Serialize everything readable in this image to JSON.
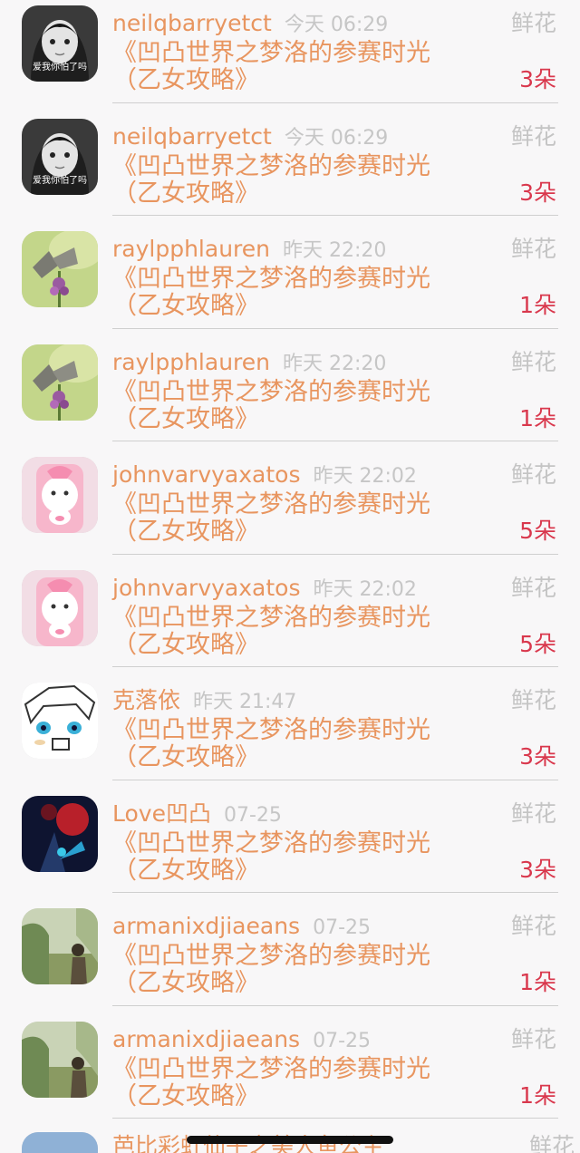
{
  "gifts": [
    {
      "user": "neilqbarryetct",
      "time": "今天 06:29",
      "gift": "鲜花",
      "message": "《凹凸世界之梦洛的参赛时光（乙女攻略》",
      "count": "3朵",
      "avatar_icon": "avatar-girl-bw-icon",
      "avatar_caption": "爱我你怕了吗"
    },
    {
      "user": "neilqbarryetct",
      "time": "今天 06:29",
      "gift": "鲜花",
      "message": "《凹凸世界之梦洛的参赛时光（乙女攻略》",
      "count": "3朵",
      "avatar_icon": "avatar-girl-bw-icon",
      "avatar_caption": "爱我你怕了吗"
    },
    {
      "user": "raylpphlauren",
      "time": "昨天 22:20",
      "gift": "鲜花",
      "message": "《凹凸世界之梦洛的参赛时光（乙女攻略》",
      "count": "1朵",
      "avatar_icon": "avatar-butterfly-icon",
      "avatar_caption": ""
    },
    {
      "user": "raylpphlauren",
      "time": "昨天 22:20",
      "gift": "鲜花",
      "message": "《凹凸世界之梦洛的参赛时光（乙女攻略》",
      "count": "1朵",
      "avatar_icon": "avatar-butterfly-icon",
      "avatar_caption": ""
    },
    {
      "user": "johnvarvyaxatos",
      "time": "昨天 22:02",
      "gift": "鲜花",
      "message": "《凹凸世界之梦洛的参赛时光（乙女攻略》",
      "count": "5朵",
      "avatar_icon": "avatar-pink-toy-icon",
      "avatar_caption": ""
    },
    {
      "user": "johnvarvyaxatos",
      "time": "昨天 22:02",
      "gift": "鲜花",
      "message": "《凹凸世界之梦洛的参赛时光（乙女攻略》",
      "count": "5朵",
      "avatar_icon": "avatar-pink-toy-icon",
      "avatar_caption": ""
    },
    {
      "user": "克落依",
      "time": "昨天 21:47",
      "gift": "鲜花",
      "message": "《凹凸世界之梦洛的参赛时光（乙女攻略》",
      "count": "3朵",
      "avatar_icon": "avatar-anime-icon",
      "avatar_caption": ""
    },
    {
      "user": "Love凹凸",
      "time": "07-25",
      "gift": "鲜花",
      "message": "《凹凸世界之梦洛的参赛时光（乙女攻略》",
      "count": "3朵",
      "avatar_icon": "avatar-dark-art-icon",
      "avatar_caption": ""
    },
    {
      "user": "armanixdjiaeans",
      "time": "07-25",
      "gift": "鲜花",
      "message": "《凹凸世界之梦洛的参赛时光（乙女攻略》",
      "count": "1朵",
      "avatar_icon": "avatar-nature-photo-icon",
      "avatar_caption": ""
    },
    {
      "user": "armanixdjiaeans",
      "time": "07-25",
      "gift": "鲜花",
      "message": "《凹凸世界之梦洛的参赛时光（乙女攻略》",
      "count": "1朵",
      "avatar_icon": "avatar-nature-photo-icon",
      "avatar_caption": ""
    }
  ],
  "partial": {
    "user": "芭比彩虹仙子之美人鱼公主",
    "gift": "鲜花"
  },
  "colors": {
    "accent": "#e8955f",
    "count": "#d9384d",
    "muted": "#c4c4c4",
    "background": "#f8f7f8"
  }
}
